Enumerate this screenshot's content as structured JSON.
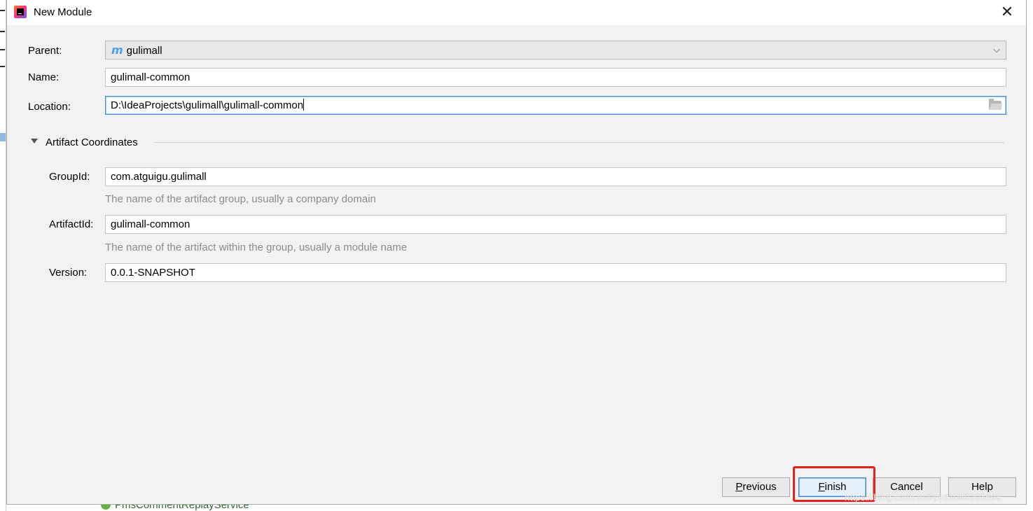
{
  "dialog": {
    "title": "New Module",
    "close_glyph": "✕"
  },
  "form": {
    "parent_label": "Parent:",
    "parent_value": "gulimall",
    "parent_icon_glyph": "m",
    "name_label": "Name:",
    "name_value": "gulimall-common",
    "location_label": "Location:",
    "location_value": "D:\\IdeaProjects\\gulimall\\gulimall-common"
  },
  "artifact": {
    "section_title": "Artifact Coordinates",
    "groupid_label": "GroupId:",
    "groupid_value": "com.atguigu.gulimall",
    "groupid_hint": "The name of the artifact group, usually a company domain",
    "artifactid_label": "ArtifactId:",
    "artifactid_value": "gulimall-common",
    "artifactid_hint": "The name of the artifact within the group, usually a module name",
    "version_label": "Version:",
    "version_value": "0.0.1-SNAPSHOT"
  },
  "buttons": {
    "previous_mnemonic": "P",
    "previous_rest": "revious",
    "finish_mnemonic": "F",
    "finish_rest": "inish",
    "cancel_label": "Cancel",
    "help_label": "Help"
  },
  "background": {
    "bottom_item": "PmsCommentReplayService"
  },
  "watermark": "https://blog.csdn.net/pyd1040201698",
  "colors": {
    "dialog_bg": "#f2f2f2",
    "focus_border": "#3d8fd6",
    "highlight": "#e8201d",
    "hint_text": "#8c8c8c"
  }
}
